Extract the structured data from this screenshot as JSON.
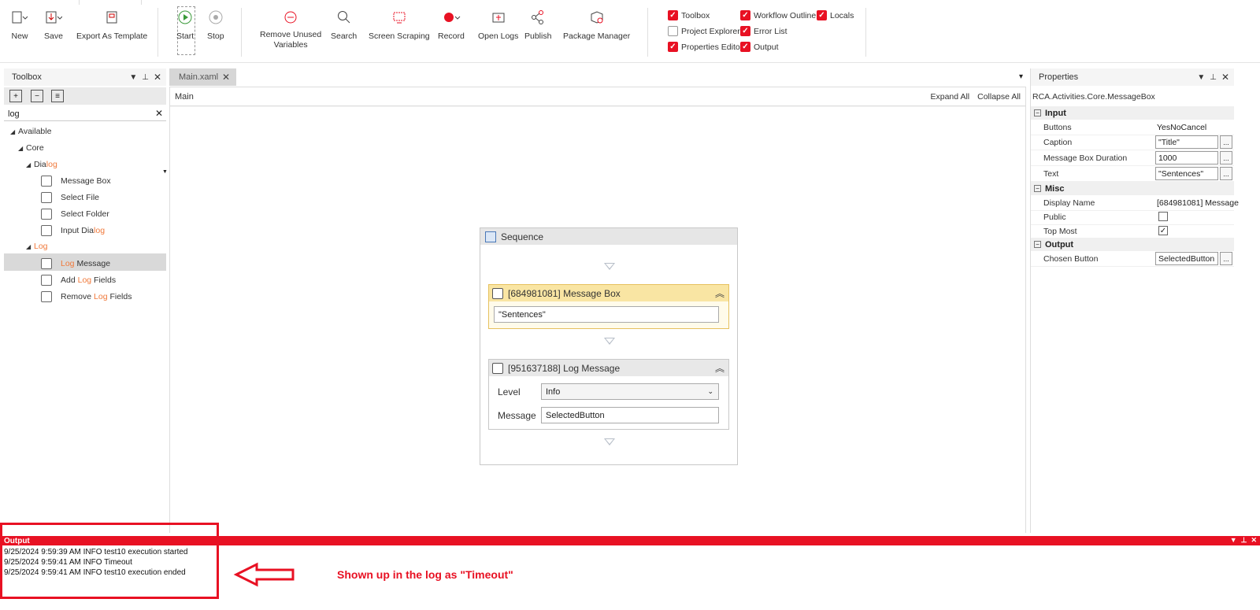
{
  "ribbon": {
    "new": "New",
    "save": "Save",
    "export": "Export As Template",
    "start": "Start",
    "stop": "Stop",
    "remove_unused_1": "Remove Unused",
    "remove_unused_2": "Variables",
    "search": "Search",
    "screen_scraping": "Screen Scraping",
    "record": "Record",
    "open_logs": "Open Logs",
    "publish": "Publish",
    "package_manager": "Package Manager",
    "checks": {
      "toolbox": "Toolbox",
      "project_explorer": "Project Explorer",
      "properties_editor": "Properties Editor",
      "workflow_outline": "Workflow Outline",
      "error_list": "Error List",
      "output": "Output",
      "locals": "Locals"
    },
    "accent": "#e81123"
  },
  "toolbox": {
    "title": "Toolbox",
    "search_value": "log",
    "available": "Available",
    "core": "Core",
    "dialog_pre": "Dia",
    "dialog_hl": "log",
    "message_box": "Message Box",
    "select_file": "Select File",
    "select_folder": "Select Folder",
    "input_dialog_pre": "Input Dia",
    "input_dialog_hl": "log",
    "log": "Log",
    "log_message_hl": "Log",
    "log_message_post": " Message",
    "add_log_pre": "Add ",
    "add_log_hl": "Log",
    "add_log_post": " Fields",
    "remove_log_pre": "Remove ",
    "remove_log_hl": "Log",
    "remove_log_post": " Fields"
  },
  "designer": {
    "tab": "Main.xaml",
    "breadcrumb": "Main",
    "expand_all": "Expand All",
    "collapse_all": "Collapse All",
    "sequence": "Sequence",
    "message_box_title": "[684981081] Message Box",
    "message_box_text": "\"Sentences\"",
    "log_message_title": "[951637188] Log Message",
    "level_label": "Level",
    "level_value": "Info",
    "message_label": "Message",
    "message_value": "SelectedButton"
  },
  "properties": {
    "title": "Properties",
    "type_name": "RCA.Activities.Core.MessageBox",
    "cat_input": "Input",
    "buttons_label": "Buttons",
    "buttons_value": "YesNoCancel",
    "caption_label": "Caption",
    "caption_value": "\"Title\"",
    "duration_label": "Message Box Duration",
    "duration_value": "1000",
    "text_label": "Text",
    "text_value": "\"Sentences\"",
    "cat_misc": "Misc",
    "display_name_label": "Display Name",
    "display_name_value": "[684981081] Message",
    "public_label": "Public",
    "top_most_label": "Top Most",
    "cat_output": "Output",
    "chosen_button_label": "Chosen Button",
    "chosen_button_value": "SelectedButton",
    "dots": "..."
  },
  "output": {
    "title": "Output",
    "lines": [
      "9/25/2024 9:59:39 AM INFO test10 execution started",
      "9/25/2024 9:59:41 AM INFO Timeout",
      "9/25/2024 9:59:41 AM INFO test10 execution ended"
    ],
    "annotation": "Shown up in the log as \"Timeout\""
  }
}
